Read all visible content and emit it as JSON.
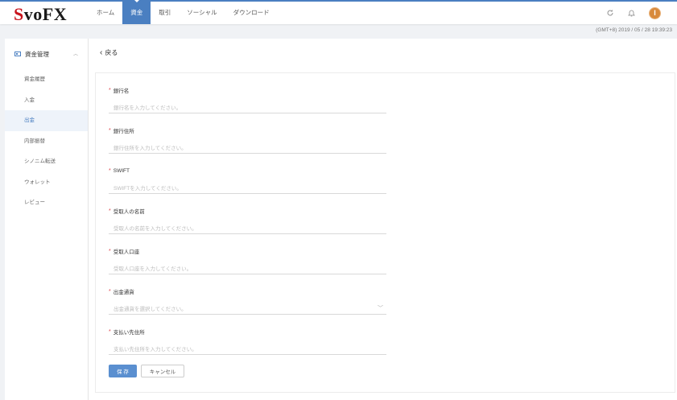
{
  "header": {
    "logo_s": "S",
    "logo_rest": "voFX",
    "nav": [
      "ホーム",
      "資金",
      "取引",
      "ソーシャル",
      "ダウンロード"
    ],
    "active_nav": "資金",
    "avatar_letter": "I"
  },
  "timestamp": "(GMT+8) 2019 / 05 / 28 19:39:23",
  "sidebar": {
    "title": "資金管理",
    "items": [
      "資金履歴",
      "入金",
      "出金",
      "内部振替",
      "シノニム転送",
      "ウォレット",
      "レビュー"
    ],
    "active_item": "出金"
  },
  "main": {
    "back_label": "戻る",
    "fields": [
      {
        "label": "銀行名",
        "placeholder": "銀行名を入力してください。"
      },
      {
        "label": "銀行住所",
        "placeholder": "銀行住所を入力してください。"
      },
      {
        "label": "SWIFT",
        "placeholder": "SWIFTを入力してください。"
      },
      {
        "label": "受取人の名前",
        "placeholder": "受取人の名前を入力してください。"
      },
      {
        "label": "受取人口座",
        "placeholder": "受取人口座を入力してください。"
      },
      {
        "label": "出金通貨",
        "placeholder": "出金通貨を選択してください。",
        "dropdown": true
      },
      {
        "label": "支払い先住所",
        "placeholder": "支払い先住所を入力してください。"
      }
    ],
    "save_label": "保 存",
    "cancel_label": "キャンセル"
  },
  "colors": {
    "accent": "#4a7fc1",
    "brand_red": "#c8141e",
    "required": "#e0454b",
    "avatar": "#d88a3c"
  }
}
